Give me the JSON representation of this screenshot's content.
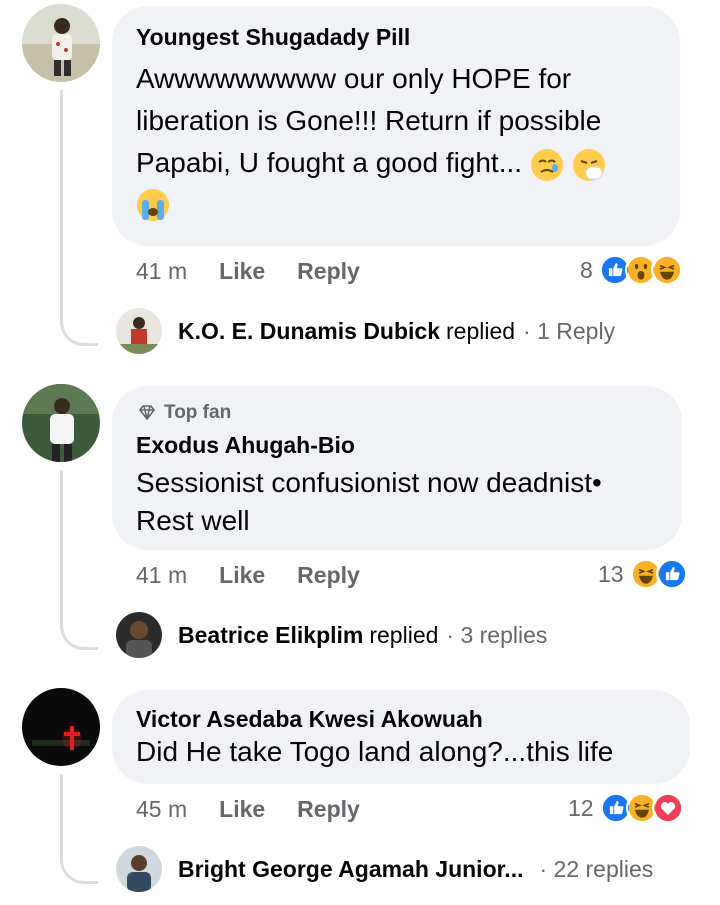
{
  "comments": [
    {
      "author": "Youngest Shugadady Pill",
      "text_line1": "Awwwwwwwww our only HOPE for",
      "text_line2": "liberation is Gone!!! Return if possible",
      "text_line3": "Papabi, U fought a good fight...",
      "time": "41 m",
      "like": "Like",
      "reply": "Reply",
      "reaction_count": "8",
      "reply_author": "K.O. E. Dunamis Dubick",
      "reply_verb": "replied",
      "reply_count": "· 1 Reply"
    },
    {
      "badge": "Top fan",
      "author": "Exodus Ahugah-Bio",
      "text_line1": "Sessionist confusionist now deadnist•",
      "text_line2": "Rest well",
      "time": "41 m",
      "like": "Like",
      "reply": "Reply",
      "reaction_count": "13",
      "reply_author": "Beatrice Elikplim",
      "reply_verb": "replied",
      "reply_count": "· 3 replies"
    },
    {
      "author": "Victor Asedaba Kwesi Akowuah",
      "text_line1": "Did He take Togo land along?...this life",
      "time": "45 m",
      "like": "Like",
      "reply": "Reply",
      "reaction_count": "12",
      "reply_author": "Bright George Agamah Junior...",
      "reply_count": "· 22 replies"
    }
  ],
  "colors": {
    "bubble": "#f0f2f5",
    "secondary_text": "#65676b",
    "like_blue": "#1877f2",
    "love_red": "#f33e58",
    "haha_yellow": "#f7b125"
  },
  "icons": [
    "like-reaction-icon",
    "wow-reaction-icon",
    "haha-reaction-icon",
    "love-reaction-icon",
    "diamond-icon",
    "sad-emoji-icon",
    "sneeze-emoji-icon",
    "crying-emoji-icon"
  ]
}
